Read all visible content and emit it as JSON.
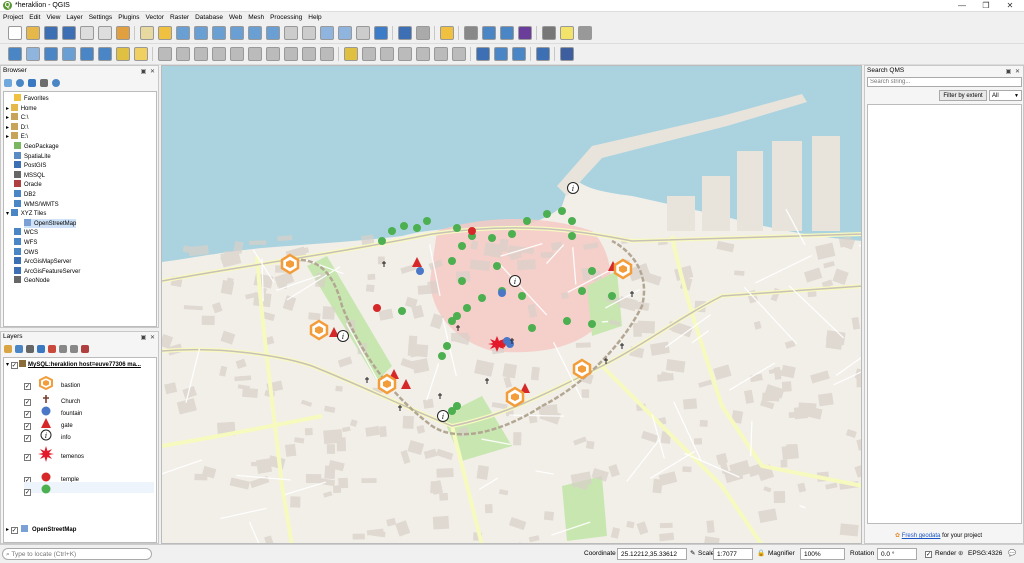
{
  "window": {
    "title": "*heraklion - QGIS",
    "logo": "Q"
  },
  "menu": [
    "Project",
    "Edit",
    "View",
    "Layer",
    "Settings",
    "Plugins",
    "Vector",
    "Raster",
    "Database",
    "Web",
    "Mesh",
    "Processing",
    "Help"
  ],
  "browser": {
    "title": "Browser",
    "items": [
      "Favorites",
      "Home",
      "C:\\",
      "D:\\",
      "E:\\",
      "GeoPackage",
      "SpatiaLite",
      "PostGIS",
      "MSSQL",
      "Oracle",
      "DB2",
      "WMS/WMTS",
      "XYZ Tiles",
      "OpenStreetMap",
      "WCS",
      "WFS",
      "OWS",
      "ArcGisMapServer",
      "ArcGisFeatureServer",
      "GeoNode"
    ]
  },
  "layers": {
    "title": "Layers",
    "group": "MySQL:heraklion host=euve77306 ma...",
    "items": [
      "bastion",
      "Church",
      "fountain",
      "gate",
      "info",
      "temenos",
      "temple",
      ""
    ],
    "basemap": "OpenStreetMap"
  },
  "qms": {
    "title": "Search QMS",
    "search_placeholder": "Search string...",
    "filter_button": "Filter by extent",
    "filter_select": "All",
    "footer_link": "Fresh geodata",
    "footer_text": " for your project"
  },
  "status": {
    "locate_placeholder": "Type to locate (Ctrl+K)",
    "coordinate_label": "Coordinate",
    "coordinate_value": "25.12212,35.33612",
    "scale_label": "Scale",
    "scale_value": "1:7077",
    "magnifier_label": "Magnifier",
    "magnifier_value": "100%",
    "rotation_label": "Rotation",
    "rotation_value": "0.0 °",
    "render_label": "Render",
    "crs": "EPSG:4326"
  },
  "colors": {
    "sea": "#aad3df",
    "land": "#f2efe9",
    "oldtown": "#f6c9c4",
    "park": "#c8e7b0",
    "road": "#f7fabf",
    "accent": "#589632"
  }
}
